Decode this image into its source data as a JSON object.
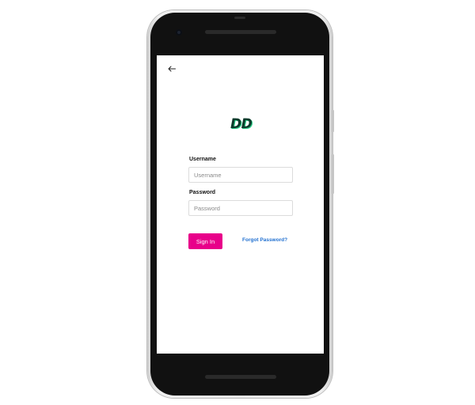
{
  "screen": {
    "back_icon": "arrow-left-icon",
    "logo_text": "DD",
    "username": {
      "label": "Username",
      "placeholder": "Username",
      "value": ""
    },
    "password": {
      "label": "Password",
      "placeholder": "Password",
      "value": ""
    },
    "sign_in_label": "Sign In",
    "forgot_password_label": "Forgot Password?"
  },
  "colors": {
    "accent": "#e8008a",
    "link": "#1f6fd0",
    "logo": "#0d3b2b",
    "logo_shadow": "#2bd18a"
  }
}
